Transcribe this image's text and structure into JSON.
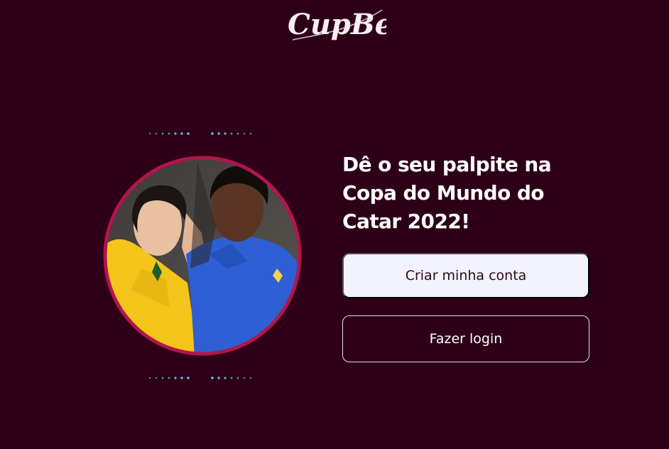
{
  "brand": {
    "logo_text": "CupBet",
    "accent": "#b0164a",
    "background": "#2d0018"
  },
  "hero": {
    "image_alt": "Two people wearing Brazil national team jerseys",
    "frame_color": "#b0164a",
    "dot_color": "#67b3e8"
  },
  "content": {
    "headline_lines": [
      "Dê o seu palpite na",
      "Copa do Mundo do",
      "Catar 2022!"
    ],
    "create_account_label": "Criar minha conta",
    "login_label": "Fazer login"
  }
}
